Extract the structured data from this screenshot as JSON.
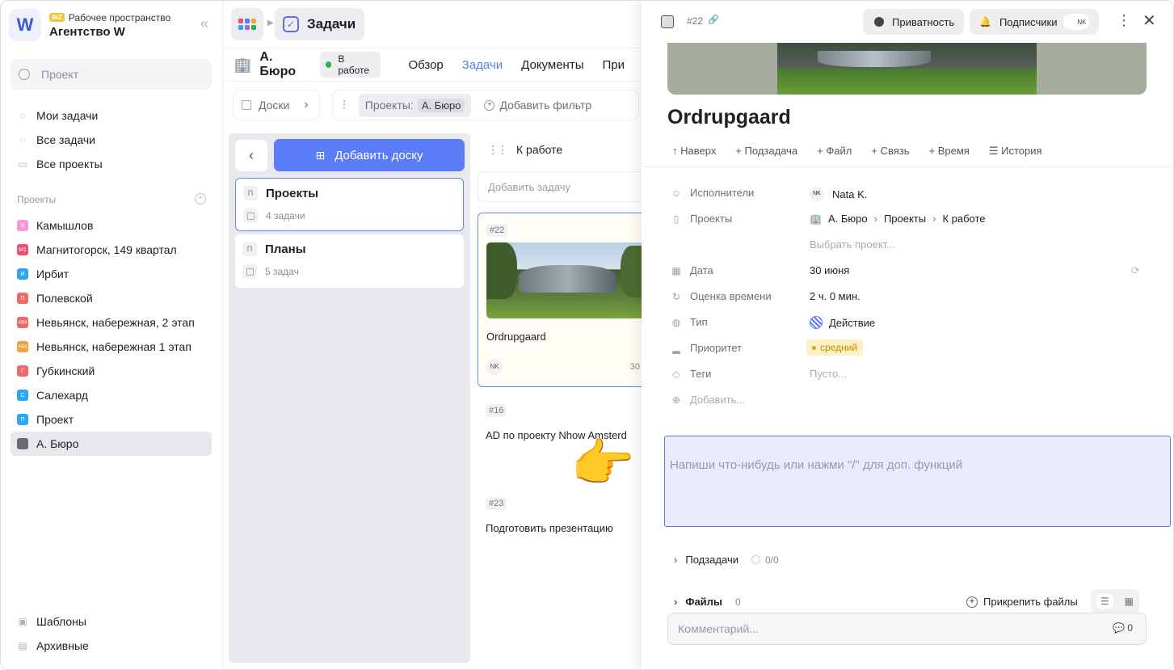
{
  "sidebar": {
    "workspace_label": "Рабочее пространство",
    "workspace_badge": "BIZ",
    "workspace_name": "Агентство W",
    "logo": "W",
    "search_placeholder": "Проект",
    "nav": [
      {
        "label": "Мои задачи",
        "icon": "circle-check-icon"
      },
      {
        "label": "Все задачи",
        "icon": "circle-check-icon"
      },
      {
        "label": "Все проекты",
        "icon": "folder-icon"
      }
    ],
    "projects_title": "Проекты",
    "projects": [
      {
        "label": "Камышлов",
        "badge": "К",
        "color": "#f39ad6"
      },
      {
        "label": "Магнитогорск, 149 квартал",
        "badge": "М1",
        "color": "#f0506e"
      },
      {
        "label": "Ирбит",
        "badge": "И",
        "color": "#2ea7f2"
      },
      {
        "label": "Полевской",
        "badge": "П",
        "color": "#f06a6a"
      },
      {
        "label": "Невьянск, набережная, 2 этап",
        "badge": "НН",
        "color": "#f06a6a"
      },
      {
        "label": "Невьянск, набережная 1 этап",
        "badge": "НН",
        "color": "#f5a23c"
      },
      {
        "label": "Губкинский",
        "badge": "Г",
        "color": "#f06a6a"
      },
      {
        "label": "Салехард",
        "badge": "С",
        "color": "#2ea7f2"
      },
      {
        "label": "Проект",
        "badge": "П",
        "color": "#2ea7f2"
      },
      {
        "label": "А. Бюро",
        "badge": "",
        "color": "#6b6b75"
      }
    ],
    "bottom": [
      {
        "label": "Шаблоны",
        "icon": "templates-icon"
      },
      {
        "label": "Архивные",
        "icon": "archive-icon"
      }
    ]
  },
  "middle": {
    "top_title": "Задачи",
    "project_name": "А. Бюро",
    "status": "В работе",
    "tabs": [
      "Обзор",
      "Задачи",
      "Документы",
      "При"
    ],
    "active_tab": "Задачи",
    "boards_label": "Доски",
    "filter_projects_label": "Проекты:",
    "filter_projects_value": "А. Бюро",
    "add_filter": "Добавить фильтр",
    "add_board": "Добавить доску",
    "boards": [
      {
        "letter": "П",
        "title": "Проекты",
        "count": "4 задачи"
      },
      {
        "letter": "П",
        "title": "Планы",
        "count": "5 задач"
      }
    ],
    "column_title": "К работе",
    "add_task": "Добавить задачу",
    "cards": [
      {
        "num": "#22",
        "title": "Ordrupgaard",
        "avatar": "NK",
        "date": "30"
      },
      {
        "num": "#16",
        "title": "AD по проекту Nhow Amsterd"
      },
      {
        "num": "#23",
        "title": "Подготовить презентацию"
      }
    ]
  },
  "panel": {
    "task_num": "#22",
    "privacy": "Приватность",
    "subscribers": "Подписчики",
    "subscriber_avatar": "NK",
    "title": "Ordrupgaard",
    "actions": [
      "Наверх",
      "Подзадача",
      "Файл",
      "Связь",
      "Время",
      "История"
    ],
    "props": {
      "assignees_label": "Исполнители",
      "assignee_initials": "NK",
      "assignee": "Nata K.",
      "projects_label": "Проекты",
      "path": [
        "А. Бюро",
        "Проекты",
        "К работе"
      ],
      "choose_project": "Выбрать проект...",
      "date_label": "Дата",
      "date": "30 июня",
      "estimate_label": "Оценка времени",
      "estimate": "2 ч. 0 мин.",
      "type_label": "Тип",
      "type": "Действие",
      "priority_label": "Приоритет",
      "priority": "средний",
      "tags_label": "Теги",
      "tags": "Пусто...",
      "add_label": "Добавить..."
    },
    "editor_placeholder": "Напиши что-нибудь или нажми \"/\" для доп. функций",
    "subtasks_label": "Подзадачи",
    "subtasks_count": "0/0",
    "files_label": "Файлы",
    "files_count": "0",
    "attach": "Прикрепить файлы",
    "comment_placeholder": "Комментарий...",
    "comments_count": "0"
  }
}
